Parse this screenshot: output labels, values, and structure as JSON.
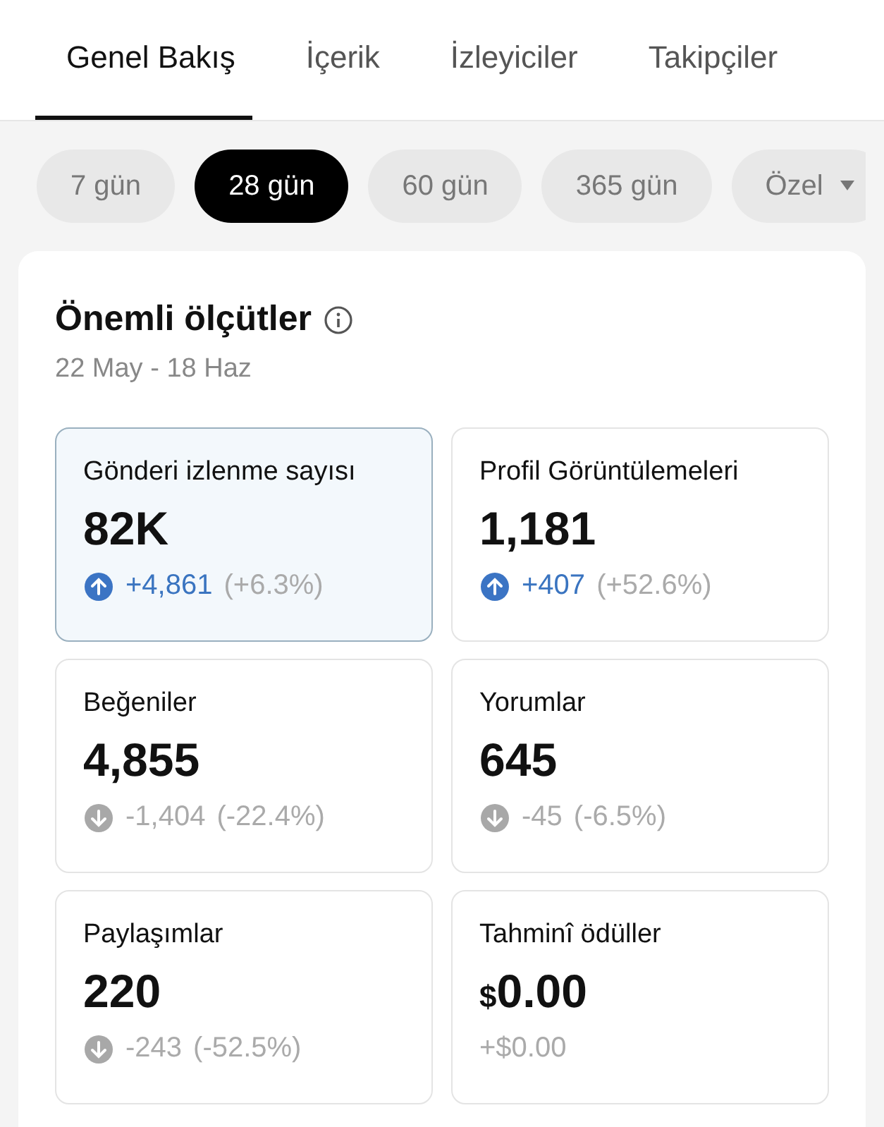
{
  "tabs": [
    {
      "label": "Genel Bakış",
      "selected": true
    },
    {
      "label": "İçerik",
      "selected": false
    },
    {
      "label": "İzleyiciler",
      "selected": false
    },
    {
      "label": "Takipçiler",
      "selected": false
    }
  ],
  "periods": [
    {
      "label": "7 gün",
      "selected": false
    },
    {
      "label": "28 gün",
      "selected": true
    },
    {
      "label": "60 gün",
      "selected": false
    },
    {
      "label": "365 gün",
      "selected": false
    },
    {
      "label": "Özel",
      "selected": false,
      "kind": "dropdown"
    }
  ],
  "metrics_panel": {
    "title": "Önemli ölçütler",
    "date_range": "22 May - 18 Haz",
    "metrics": [
      {
        "label": "Gönderi izlenme sayısı",
        "value": "82K",
        "kind": "up",
        "delta": "+4,861",
        "percent": "(+6.3%)",
        "selected": true
      },
      {
        "label": "Profil Görüntülemeleri",
        "value": "1,181",
        "kind": "up",
        "delta": "+407",
        "percent": "(+52.6%)",
        "selected": false
      },
      {
        "label": "Beğeniler",
        "value": "4,855",
        "kind": "down",
        "delta": "-1,404",
        "percent": "(-22.4%)",
        "selected": false
      },
      {
        "label": "Yorumlar",
        "value": "645",
        "kind": "down",
        "delta": "-45",
        "percent": "(-6.5%)",
        "selected": false
      },
      {
        "label": "Paylaşımlar",
        "value": "220",
        "kind": "down",
        "delta": "-243",
        "percent": "(-52.5%)",
        "selected": false
      },
      {
        "label": "Tahminî ödüller",
        "currency": "$",
        "value": "0.00",
        "kind": "none",
        "delta": "+$0.00",
        "selected": false
      }
    ]
  }
}
